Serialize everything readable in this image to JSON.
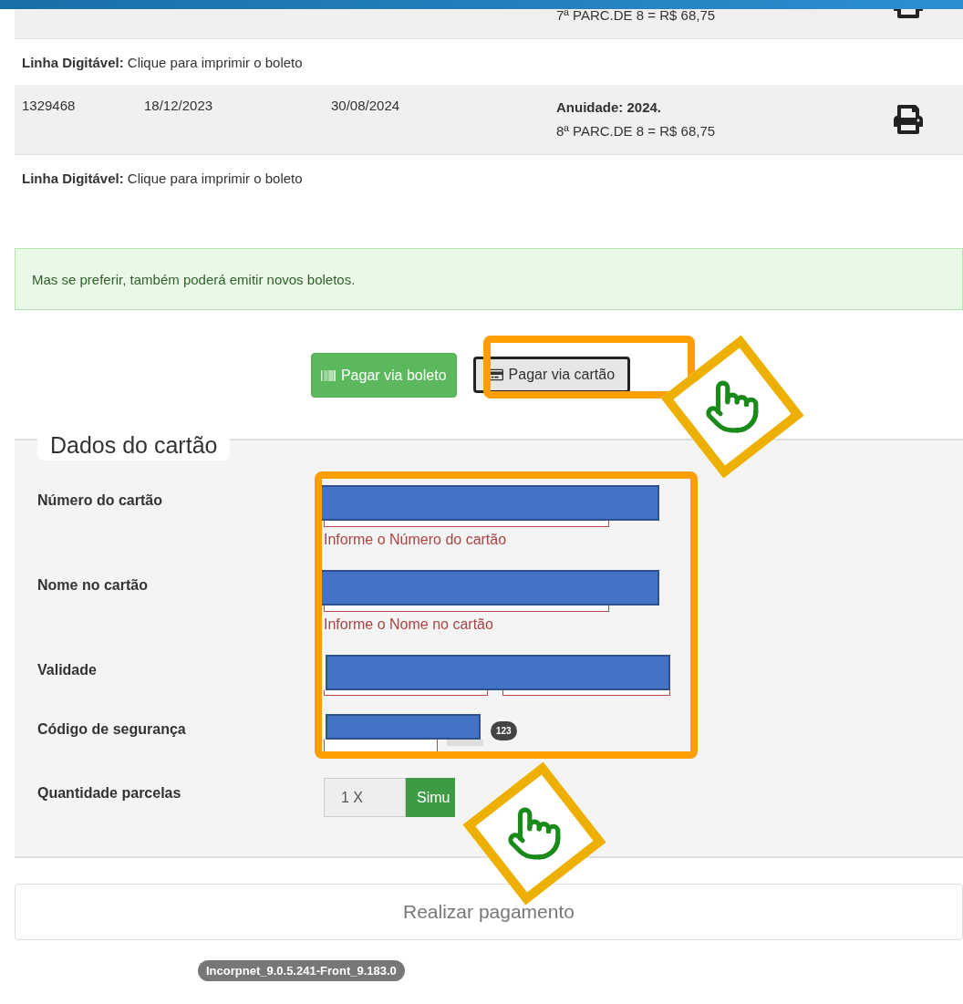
{
  "installments": [
    {
      "parcel": "7ª PARC.DE 8 = R$ 68,75",
      "line_label": "Linha Digitável:",
      "line_text": "Clique para imprimir o boleto"
    },
    {
      "id": "1329468",
      "issued": "18/12/2023",
      "due": "30/08/2024",
      "title": "Anuidade: 2024.",
      "parcel": "8ª PARC.DE 8 = R$ 68,75",
      "line_label": "Linha Digitável:",
      "line_text": "Clique para imprimir o boleto"
    }
  ],
  "alert": "Mas se preferir, também poderá emitir novos boletos.",
  "pay_tabs": [
    {
      "label": "Pagar via boleto",
      "kind": "boleto",
      "selected": false
    },
    {
      "label": "Pagar via cartão",
      "kind": "card",
      "selected": true
    }
  ],
  "card_form": {
    "legend": "Dados do cartão",
    "fields": [
      {
        "label": "Número do cartão",
        "kind": "text",
        "error": "Informe o Número do cartão"
      },
      {
        "label": "Nome no cartão",
        "kind": "text",
        "error": "Informe o Nome no cartão"
      },
      {
        "label": "Validade",
        "kind": "expiry"
      },
      {
        "label": "Código de segurança",
        "kind": "cvv",
        "badge": "123"
      },
      {
        "label": "Quantidade parcelas",
        "kind": "installments",
        "value": "1 X",
        "button": "Simu"
      }
    ]
  },
  "submit": "Realizar pagamento",
  "version": "Incorpnet_9.0.5.241-Front_9.183.0"
}
